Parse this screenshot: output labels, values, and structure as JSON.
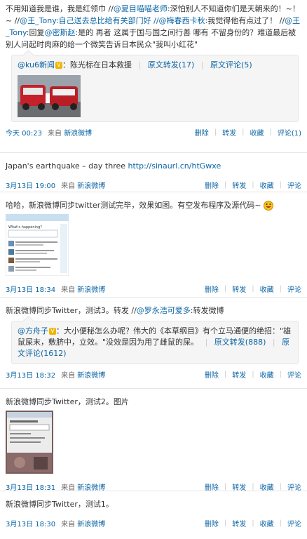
{
  "common": {
    "from": "来自",
    "source": "新浪微博",
    "delete": "删除",
    "forward": "转发",
    "favorite": "收藏",
    "comment": "评论",
    "sep": "|"
  },
  "posts": [
    {
      "text_segments": [
        {
          "t": "不用知道我是谁，我是红领巾 //",
          "link": false
        },
        {
          "t": "@夏目喵喵老师",
          "link": true
        },
        {
          "t": ":深怕别人不知道你们是天朝来的！~！~ //",
          "link": false
        },
        {
          "t": "@王_Tony",
          "link": true
        },
        {
          "t": ":自己送去总比给有关部门好 //",
          "link": true
        },
        {
          "t": "@梅春西卡秋",
          "link": true
        },
        {
          "t": ":我觉得他有点过了！ //",
          "link": false
        },
        {
          "t": "@王_Tony",
          "link": true
        },
        {
          "t": ":回复",
          "link": false
        },
        {
          "t": "@密斯赵",
          "link": true
        },
        {
          "t": ":是的 再者 这属于国与国之间行善 哪有 不留身份的？难道最后被别人问起时肉麻的给一个微笑告诉日本民众\"我叫小红花\"",
          "link": false
        }
      ],
      "quote": {
        "author": "@ku6新闻",
        "text": "：陈光标在日本救援",
        "forward": "原文转发(17)",
        "comment": "原文评论(5)",
        "has_image": true
      },
      "time": "今天 00:23",
      "comment": "评论(1)"
    },
    {
      "text": "Japan's earthquake – day three ",
      "link": "http://sinaurl.cn/htGwxe",
      "time": "3月13日 19:00"
    },
    {
      "text": "哈哈，新浪微博同步twitter测试完毕，效果如图。有空发布程序及源代码~",
      "has_emoji": true,
      "has_image": true,
      "time": "3月13日 18:34"
    },
    {
      "text": "新浪微博同步Twitter，测试3。转发 //",
      "mention": "@罗永浩可爱多",
      "tail": ":转发微博",
      "quote": {
        "author": "@方舟子",
        "text": "：大小便秘怎么办呢？伟大的《本草纲目》有个立马通便的绝招：\"雄鼠屎末，敷脐中，立效。\"没效是因为用了雌鼠的屎。",
        "forward": "原文转发(888)",
        "comment": "原文评论(1612)"
      },
      "time": "3月13日 18:32"
    },
    {
      "text": "新浪微博同步Twitter，测试2。图片",
      "has_image": true,
      "time": "3月13日 18:31"
    },
    {
      "text": "新浪微博同步Twitter，测试1。",
      "time": "3月13日 18:30"
    }
  ]
}
